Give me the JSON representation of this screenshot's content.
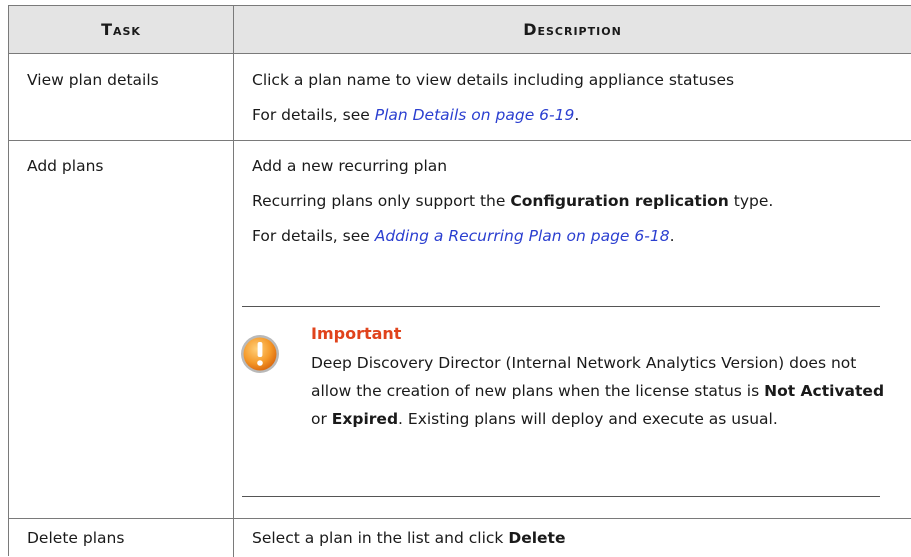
{
  "headers": {
    "task": "Task",
    "description": "Description"
  },
  "rows": [
    {
      "task": "View plan details",
      "line1": "Click a plan name to view details including appliance statuses",
      "details_prefix": "For details, see ",
      "details_link": "Plan Details on page 6-19",
      "details_suffix": "."
    },
    {
      "task": "Add plans",
      "line1": "Add a new recurring plan",
      "line2_a": "Recurring plans only support the ",
      "line2_bold": "Configuration replication",
      "line2_b": " type.",
      "details_prefix": "For details, see ",
      "details_link": "Adding a Recurring Plan on page 6-18",
      "details_suffix": ".",
      "important": {
        "title": "Important",
        "text_a": "Deep Discovery Director (Internal Network Analytics Version) does not allow the creation of new plans when the license status is ",
        "bold1": "Not Activated",
        "text_b": " or ",
        "bold2": "Expired",
        "text_c": ". Existing plans will deploy and execute as usual.",
        "icon": "warning-icon",
        "color": "#e0431c"
      }
    },
    {
      "task": "Delete plans",
      "line1": "Select a plan in the list and click ",
      "line1_bold": "Delete"
    }
  ],
  "colors": {
    "header_bg": "#e4e4e4",
    "link": "#2b3fd0",
    "important": "#e0431c",
    "icon_orange": "#f08a1c"
  }
}
